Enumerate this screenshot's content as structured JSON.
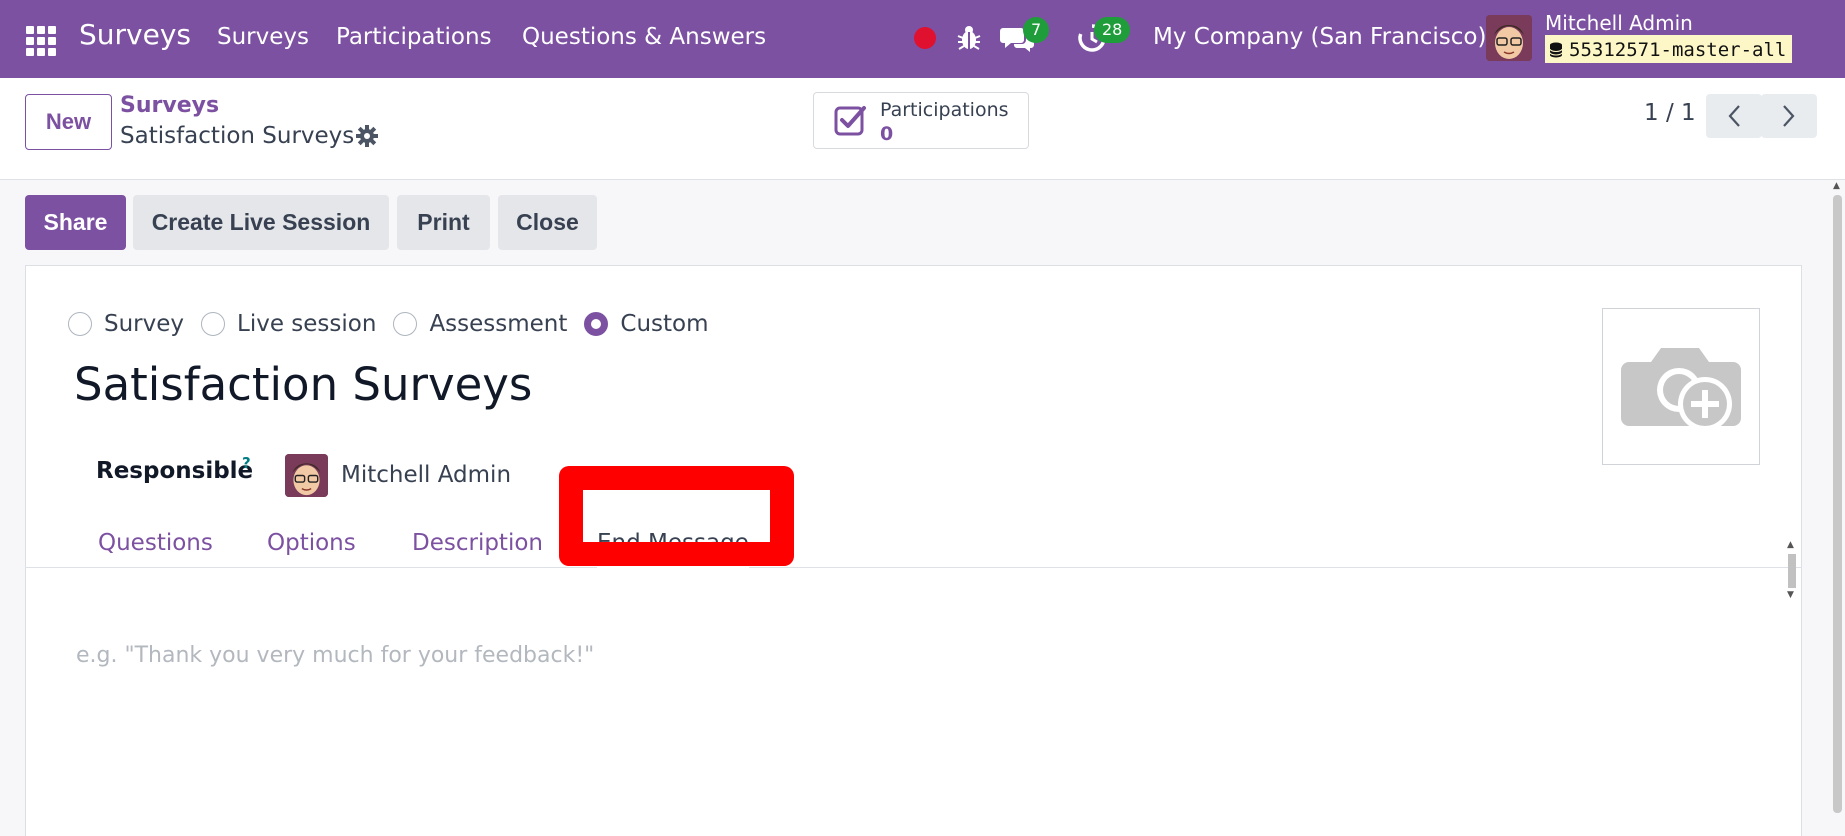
{
  "navbar": {
    "app_name": "Surveys",
    "menu": [
      "Surveys",
      "Participations",
      "Questions & Answers"
    ],
    "chat_count": "7",
    "activity_count": "28",
    "company": "My Company (San Francisco)",
    "user_name": "Mitchell Admin",
    "database": "55312571-master-all",
    "icons": [
      "apps-icon",
      "record-icon",
      "bug-icon",
      "chat-icon",
      "clock-icon",
      "database-icon"
    ]
  },
  "control_panel": {
    "new_label": "New",
    "breadcrumb_parent": "Surveys",
    "breadcrumb_current": "Satisfaction Surveys",
    "smart_button": {
      "label": "Participations",
      "count": "0"
    },
    "pager": "1 / 1"
  },
  "actions": {
    "share": "Share",
    "create_live_session": "Create Live Session",
    "print": "Print",
    "close": "Close"
  },
  "form": {
    "survey_types": [
      {
        "label": "Survey",
        "checked": false
      },
      {
        "label": "Live session",
        "checked": false
      },
      {
        "label": "Assessment",
        "checked": false
      },
      {
        "label": "Custom",
        "checked": true
      }
    ],
    "title": "Satisfaction Surveys",
    "responsible_label": "Responsible",
    "responsible_help": "?",
    "responsible_name": "Mitchell Admin",
    "tabs": [
      {
        "label": "Questions",
        "active": false
      },
      {
        "label": "Options",
        "active": false
      },
      {
        "label": "Description",
        "active": false
      },
      {
        "label": "End Message",
        "active": true
      }
    ],
    "end_message_placeholder": "e.g. \"Thank you very much for your feedback!\""
  },
  "colors": {
    "brand": "#7c51a1",
    "highlight": "#ff0000",
    "badge": "#1f9d3a",
    "record": "#e0102f"
  }
}
